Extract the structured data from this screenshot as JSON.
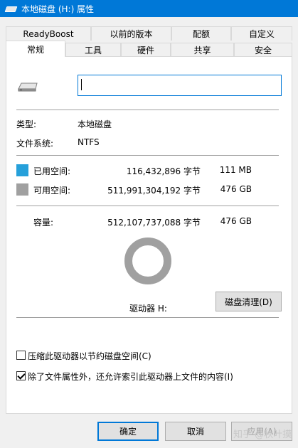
{
  "window": {
    "title": "本地磁盘 (H:) 属性"
  },
  "tabs_row1": [
    "ReadyBoost",
    "以前的版本",
    "配额",
    "自定义"
  ],
  "tabs_row2": [
    "常规",
    "工具",
    "硬件",
    "共享",
    "安全"
  ],
  "general": {
    "name_value": "",
    "type_label": "类型:",
    "type_value": "本地磁盘",
    "fs_label": "文件系统:",
    "fs_value": "NTFS",
    "used_label": "已用空间:",
    "used_bytes": "116,432,896 字节",
    "used_size": "111 MB",
    "free_label": "可用空间:",
    "free_bytes": "511,991,304,192 字节",
    "free_size": "476 GB",
    "capacity_label": "容量:",
    "capacity_bytes": "512,107,737,088 字节",
    "capacity_size": "476 GB",
    "drive_label": "驱动器 H:",
    "cleanup_button": "磁盘清理(D)",
    "compress_label": "压缩此驱动器以节约磁盘空间(C)",
    "compress_checked": false,
    "index_label": "除了文件属性外，还允许索引此驱动器上文件的内容(I)",
    "index_checked": true
  },
  "footer": {
    "ok": "确定",
    "cancel": "取消",
    "apply": "应用(A)"
  },
  "watermark": "知乎 @秋叶摸",
  "colors": {
    "used": "#26a0da",
    "free": "#a0a0a0",
    "accent": "#0078d7"
  },
  "usage": {
    "used_fraction": 0.00023
  }
}
